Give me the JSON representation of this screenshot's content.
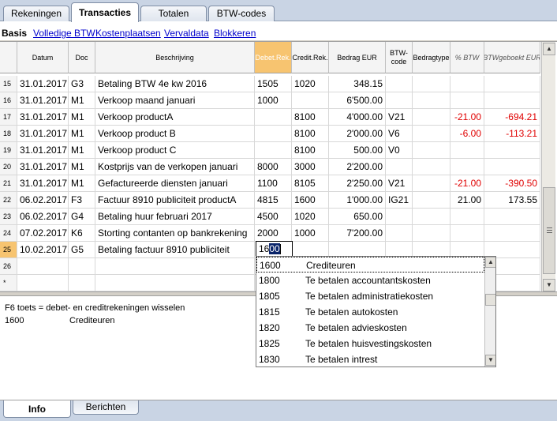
{
  "top_tabs": [
    "Rekeningen",
    "Transacties",
    "Totalen",
    "BTW-codes"
  ],
  "sub_tabs": [
    "Basis",
    "Volledige BTW",
    "Kostenplaatsen",
    "Vervaldata",
    "Blokkeren"
  ],
  "columns": [
    "Datum",
    "Doc",
    "Beschrijving",
    "Debet.Rek.",
    "Credit.Rek.",
    "Bedrag EUR",
    "BTW-code",
    "Bedragtype",
    "% BTW",
    "BTWgeboekt EUR"
  ],
  "rows": [
    {
      "num": "15",
      "date": "31.01.2017",
      "doc": "G3",
      "desc": "Betaling BTW 4e kw 2016",
      "debit": "1505",
      "credit": "1020",
      "amount": "348.15",
      "vat": "",
      "type": "",
      "pct": "",
      "booked": ""
    },
    {
      "num": "16",
      "date": "31.01.2017",
      "doc": "M1",
      "desc": "Verkoop maand januari",
      "debit": "1000",
      "credit": "",
      "amount": "6'500.00",
      "vat": "",
      "type": "",
      "pct": "",
      "booked": ""
    },
    {
      "num": "17",
      "date": "31.01.2017",
      "doc": "M1",
      "desc": "Verkoop productA",
      "debit": "",
      "credit": "8100",
      "amount": "4'000.00",
      "vat": "V21",
      "type": "",
      "pct": "-21.00",
      "booked": "-694.21"
    },
    {
      "num": "18",
      "date": "31.01.2017",
      "doc": "M1",
      "desc": "Verkoop product B",
      "debit": "",
      "credit": "8100",
      "amount": "2'000.00",
      "vat": "V6",
      "type": "",
      "pct": "-6.00",
      "booked": "-113.21"
    },
    {
      "num": "19",
      "date": "31.01.2017",
      "doc": "M1",
      "desc": "Verkoop product C",
      "debit": "",
      "credit": "8100",
      "amount": "500.00",
      "vat": "V0",
      "type": "",
      "pct": "",
      "booked": ""
    },
    {
      "num": "20",
      "date": "31.01.2017",
      "doc": "M1",
      "desc": "Kostprijs van de verkopen januari",
      "debit": "8000",
      "credit": "3000",
      "amount": "2'200.00",
      "vat": "",
      "type": "",
      "pct": "",
      "booked": ""
    },
    {
      "num": "21",
      "date": "31.01.2017",
      "doc": "M1",
      "desc": "Gefactureerde diensten januari",
      "debit": "1100",
      "credit": "8105",
      "amount": "2'250.00",
      "vat": "V21",
      "type": "",
      "pct": "-21.00",
      "booked": "-390.50"
    },
    {
      "num": "22",
      "date": "06.02.2017",
      "doc": "F3",
      "desc": "Factuur 8910 publiciteit productA",
      "debit": "4815",
      "credit": "1600",
      "amount": "1'000.00",
      "vat": "IG21",
      "type": "",
      "pct": "21.00",
      "booked": "173.55"
    },
    {
      "num": "23",
      "date": "06.02.2017",
      "doc": "G4",
      "desc": "Betaling huur februari 2017",
      "debit": "4500",
      "credit": "1020",
      "amount": "650.00",
      "vat": "",
      "type": "",
      "pct": "",
      "booked": ""
    },
    {
      "num": "24",
      "date": "07.02.2017",
      "doc": "K6",
      "desc": "Storting contanten op bankrekening",
      "debit": "2000",
      "credit": "1000",
      "amount": "7'200.00",
      "vat": "",
      "type": "",
      "pct": "",
      "booked": ""
    },
    {
      "num": "25",
      "date": "10.02.2017",
      "doc": "G5",
      "desc": "Betaling factuur 8910 publiciteit",
      "debit": "",
      "credit": "",
      "amount": "",
      "vat": "",
      "type": "",
      "pct": "",
      "booked": ""
    },
    {
      "num": "26",
      "date": "",
      "doc": "",
      "desc": "",
      "debit": "",
      "credit": "",
      "amount": "",
      "vat": "",
      "type": "",
      "pct": "",
      "booked": ""
    },
    {
      "num": "*",
      "date": "",
      "doc": "",
      "desc": "",
      "debit": "",
      "credit": "",
      "amount": "",
      "vat": "",
      "type": "",
      "pct": "",
      "booked": ""
    }
  ],
  "edit": {
    "prefix": "16",
    "selected": "00"
  },
  "dropdown": [
    {
      "code": "1600",
      "desc": "Crediteuren"
    },
    {
      "code": "1800",
      "desc": "Te betalen accountantskosten"
    },
    {
      "code": "1805",
      "desc": "Te betalen administratiekosten"
    },
    {
      "code": "1815",
      "desc": "Te betalen autokosten"
    },
    {
      "code": "1820",
      "desc": "Te betalen advieskosten"
    },
    {
      "code": "1825",
      "desc": "Te betalen huisvestingskosten"
    },
    {
      "code": "1830",
      "desc": "Te betalen intrest"
    }
  ],
  "info": {
    "line1": "F6 toets = debet- en creditrekeningen wisselen",
    "account_code": "1600",
    "account_name": "Crediteuren"
  },
  "bottom_tabs": [
    "Info",
    "Berichten"
  ],
  "colors": {
    "negative": "#e00000",
    "selected_header": "#f7c470",
    "link": "#0000cc"
  }
}
